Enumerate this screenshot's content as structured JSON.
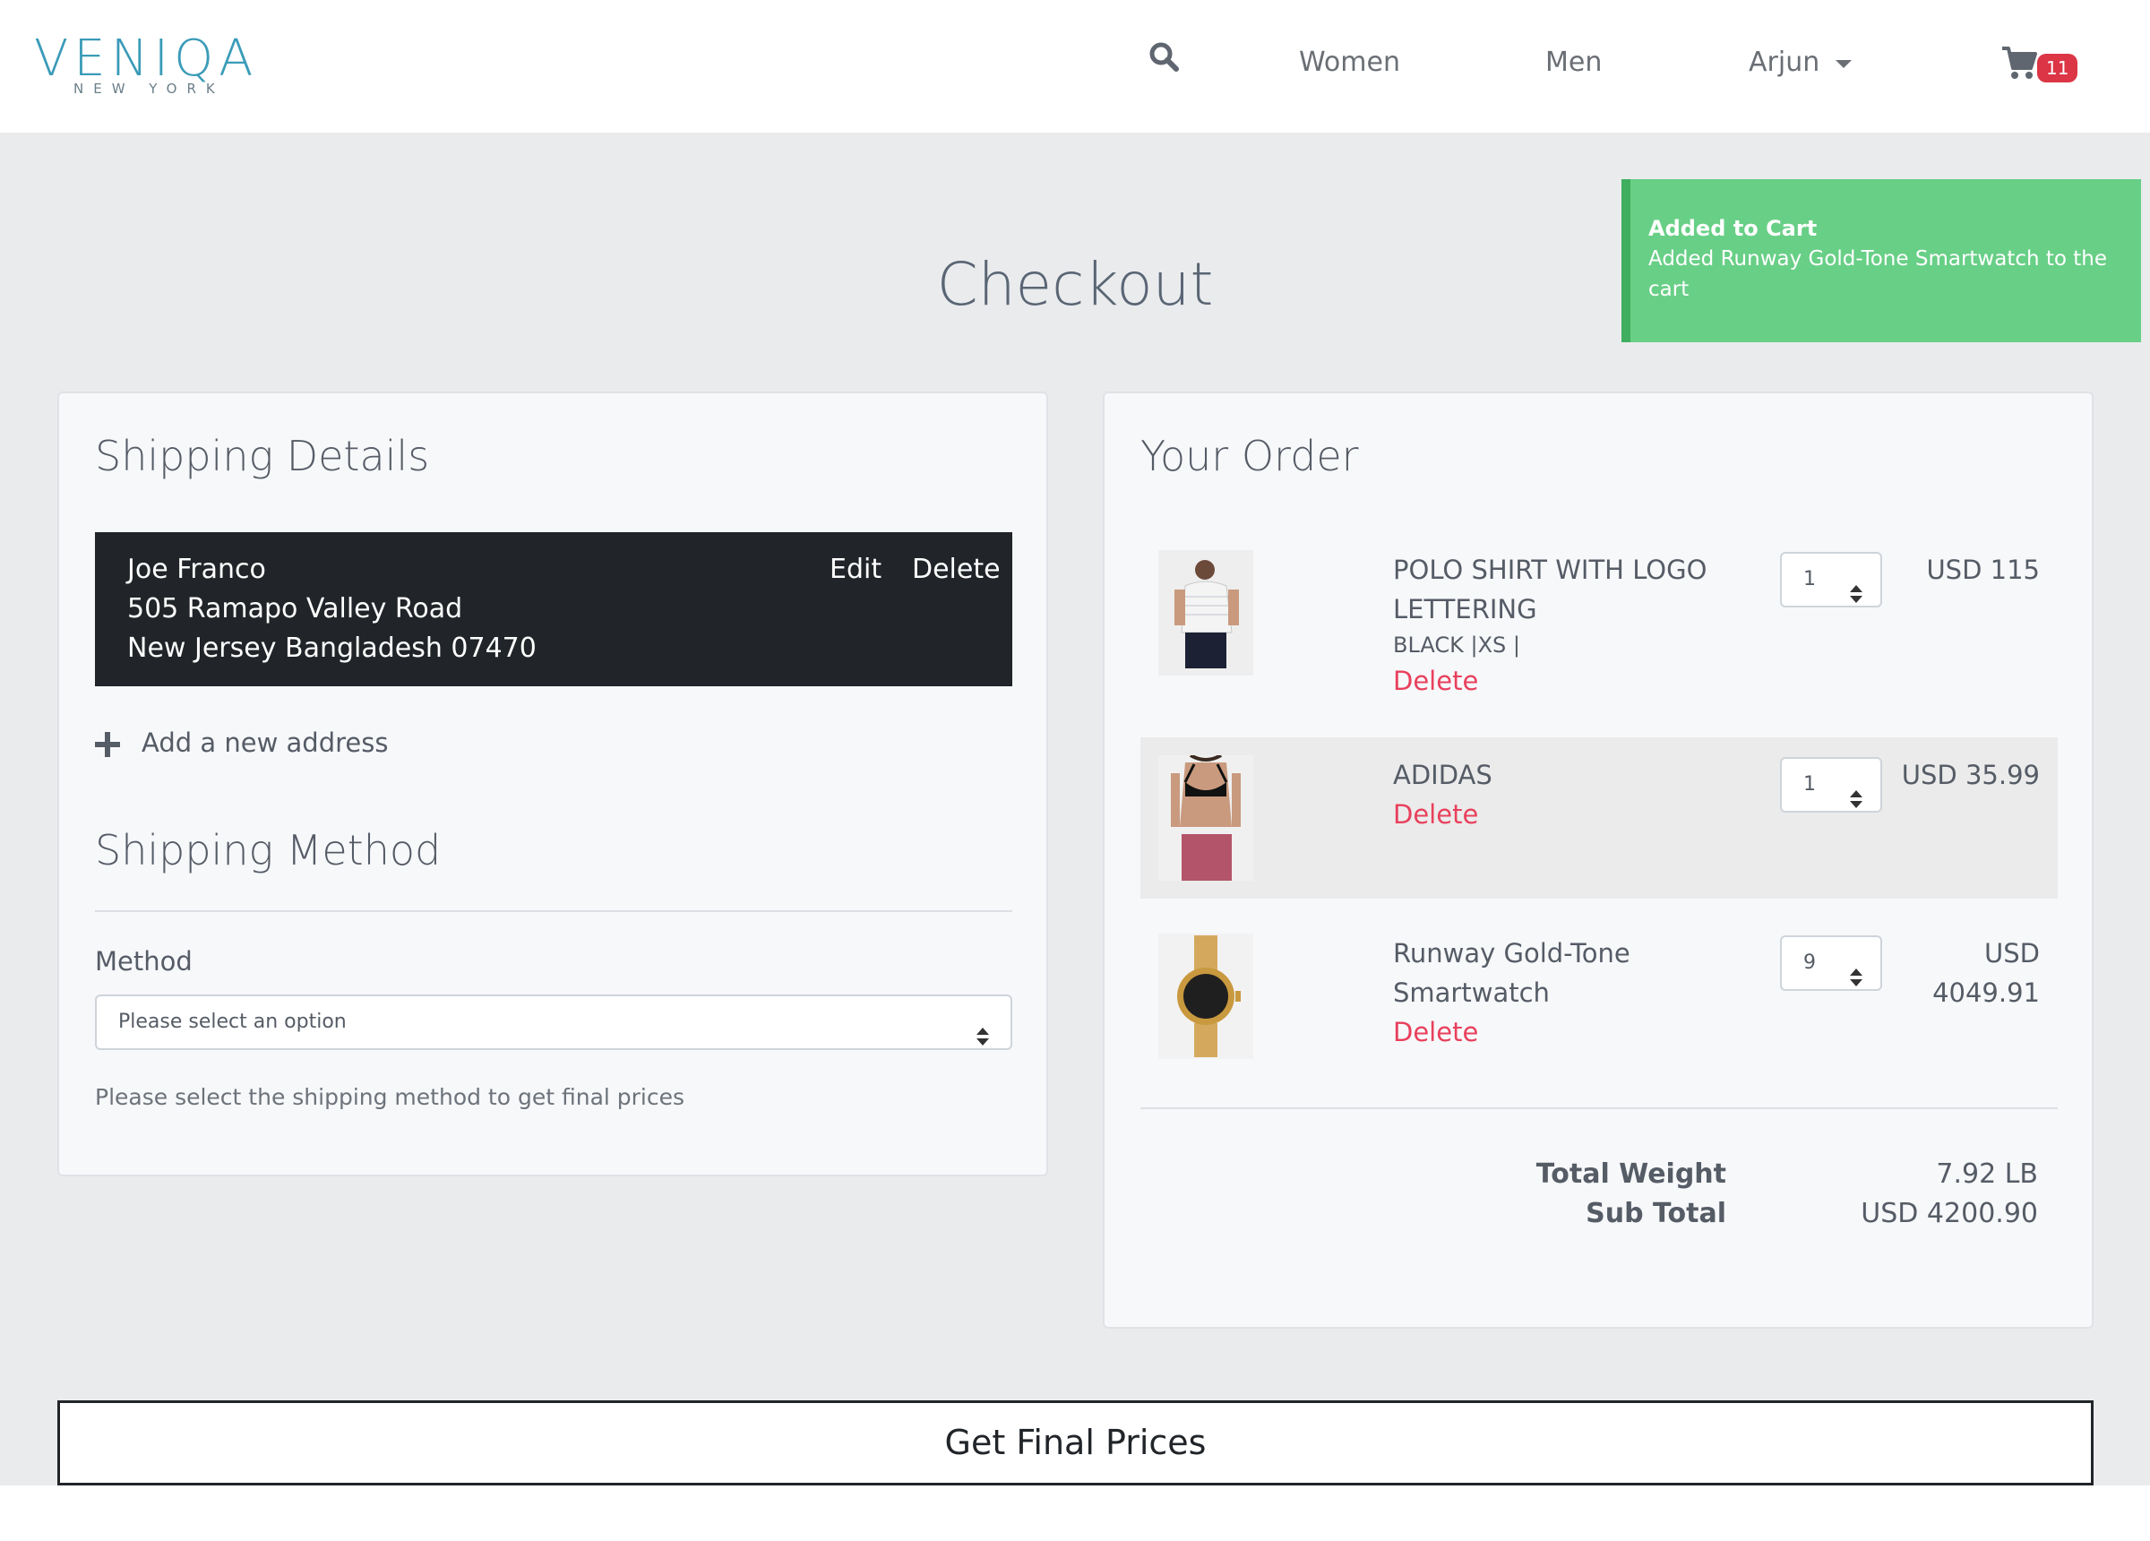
{
  "header": {
    "logo_main": "VENIQA",
    "logo_sub": "NEW YORK",
    "nav_women": "Women",
    "nav_men": "Men",
    "user_name": "Arjun",
    "cart_count": "11",
    "search_icon": "search-icon",
    "cart_icon": "shopping-cart-icon",
    "accent_color": "#3a9bb8"
  },
  "toast": {
    "title": "Added to Cart",
    "message": "Added Runway Gold-Tone Smartwatch to the cart",
    "color": "#68cf86"
  },
  "page": {
    "title": "Checkout"
  },
  "shipping": {
    "title": "Shipping Details",
    "address": {
      "name": "Joe Franco",
      "street": "505 Ramapo Valley Road",
      "city_line": "New Jersey Bangladesh 07470",
      "edit_label": "Edit",
      "delete_label": "Delete"
    },
    "add_address_label": "Add a new address",
    "method_title": "Shipping Method",
    "method_label": "Method",
    "method_placeholder": "Please select an option",
    "note": "Please select the shipping method to get final prices"
  },
  "order": {
    "title": "Your Order",
    "items": [
      {
        "name": "POLO SHIRT WITH LOGO LETTERING",
        "variant": "BLACK |XS |",
        "delete_label": "Delete",
        "quantity": "1",
        "price": "USD 115"
      },
      {
        "name": "ADIDAS",
        "variant": "",
        "delete_label": "Delete",
        "quantity": "1",
        "price": "USD 35.99"
      },
      {
        "name": "Runway Gold-Tone Smartwatch",
        "variant": "",
        "delete_label": "Delete",
        "quantity": "9",
        "price": "USD 4049.91"
      }
    ],
    "total_weight_label": "Total Weight",
    "total_weight_value": "7.92 LB",
    "subtotal_label": "Sub Total",
    "subtotal_value": "USD 4200.90",
    "delete_color": "#e8405c"
  },
  "actions": {
    "final_prices_label": "Get Final Prices"
  }
}
